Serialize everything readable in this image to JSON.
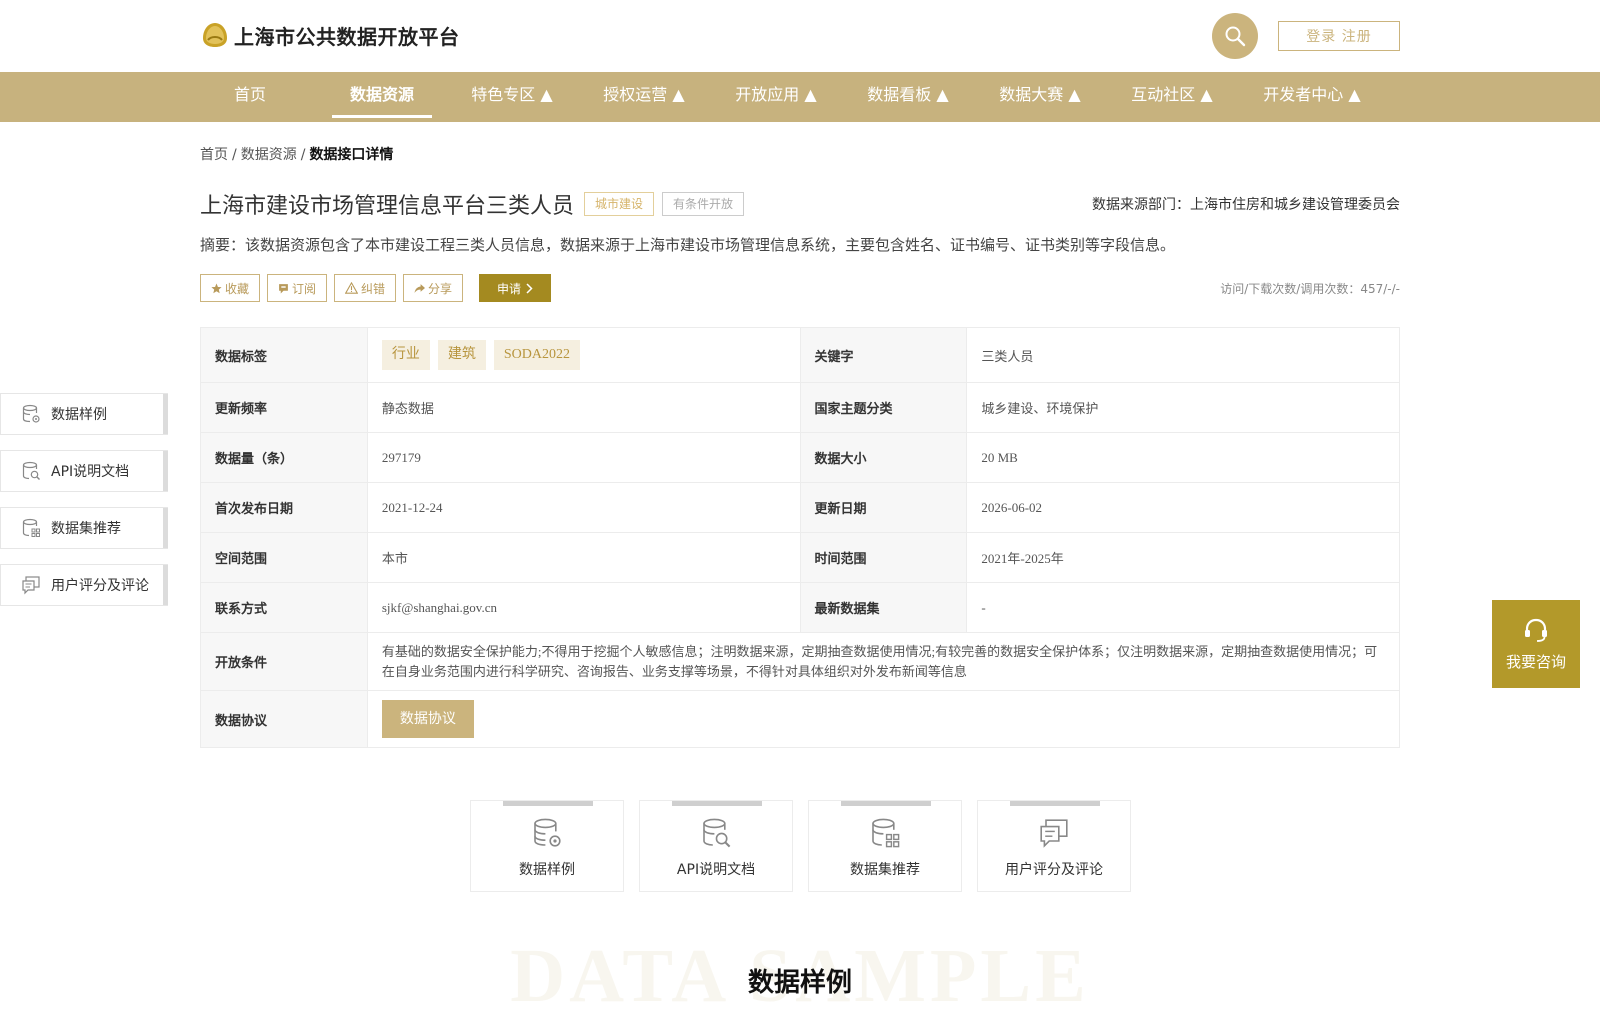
{
  "header": {
    "site_title": "上海市公共数据开放平台",
    "login_label": "登录 注册"
  },
  "nav": {
    "items": [
      "首页",
      "数据资源",
      "特色专区 ▲",
      "授权运营 ▲",
      "开放应用 ▲",
      "数据看板 ▲",
      "数据大赛 ▲",
      "互动社区 ▲",
      "开发者中心 ▲"
    ],
    "active": "数据资源"
  },
  "breadcrumb": {
    "home": "首页",
    "level2": "数据资源",
    "current": "数据接口详情",
    "sep": "/"
  },
  "dataset": {
    "title": "上海市建设市场管理信息平台三类人员",
    "tag_category": "城市建设",
    "tag_open": "有条件开放",
    "source": "数据来源部门：上海市住房和城乡建设管理委员会",
    "summary": "摘要：该数据资源包含了本市建设工程三类人员信息，数据来源于上海市建设市场管理信息系统，主要包含姓名、证书编号、证书类别等字段信息。",
    "stats": "访问/下载次数/调用次数：457/-/-"
  },
  "actions": {
    "collect": "收藏",
    "subscribe": "订阅",
    "report": "纠错",
    "share": "分享",
    "apply": "申请"
  },
  "info": {
    "tags_label": "数据标签",
    "tags": [
      "行业",
      "建筑",
      "SODA2022"
    ],
    "keyword_label": "关键字",
    "keyword": "三类人员",
    "freq_label": "更新频率",
    "freq": "静态数据",
    "theme_label": "国家主题分类",
    "theme": "城乡建设、环境保护",
    "count_label": "数据量（条）",
    "count": "297179",
    "size_label": "数据大小",
    "size": "20 MB",
    "first_label": "首次发布日期",
    "first": "2021-12-24",
    "update_label": "更新日期",
    "update": "2026-06-02",
    "space_label": "空间范围",
    "space": "本市",
    "time_label": "时间范围",
    "time": "2021年-2025年",
    "contact_label": "联系方式",
    "contact": "sjkf@shanghai.gov.cn",
    "latest_label": "最新数据集",
    "latest": "-",
    "cond_label": "开放条件",
    "cond": "有基础的数据安全保护能力;不得用于挖掘个人敏感信息；注明数据来源，定期抽查数据使用情况;有较完善的数据安全保护体系；仅注明数据来源，定期抽查数据使用情况；可在自身业务范围内进行科学研究、咨询报告、业务支撑等场景，不得针对具体组织对外发布新闻等信息",
    "protocol_label": "数据协议",
    "protocol_btn": "数据协议"
  },
  "side_nav": [
    "数据样例",
    "API说明文档",
    "数据集推荐",
    "用户评分及评论"
  ],
  "consult_label": "我要咨询",
  "cards": [
    "数据样例",
    "API说明文档",
    "数据集推荐",
    "用户评分及评论"
  ],
  "section": {
    "bg": "DATA SAMPLE",
    "title": "数据样例"
  },
  "colors": {
    "gold": "#c7b27e",
    "dark_gold": "#a48a20",
    "consult": "#b3992a"
  },
  "icons": [
    "logo-icon",
    "search-icon",
    "star-icon",
    "subscribe-icon",
    "warning-icon",
    "share-icon",
    "chevron-right-icon",
    "database-gear-icon",
    "database-search-icon",
    "database-grid-icon",
    "comment-icon",
    "headset-icon"
  ]
}
